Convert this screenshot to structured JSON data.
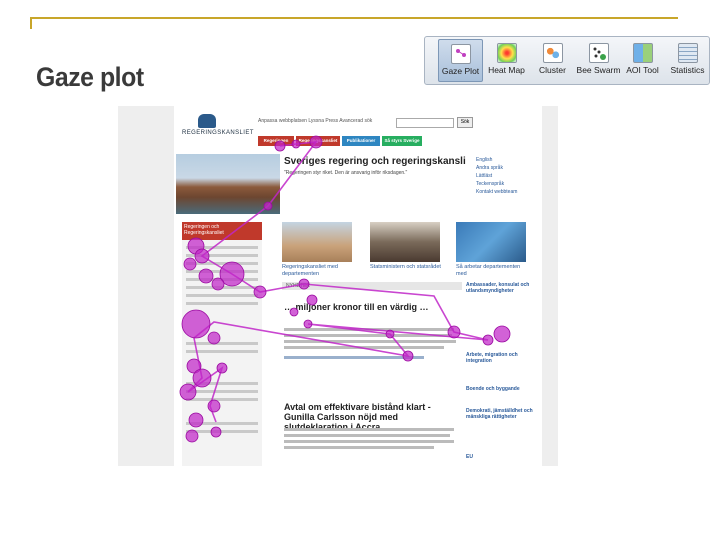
{
  "slide": {
    "title": "Gaze plot",
    "accent_color": "#c8a62a"
  },
  "toolbar": {
    "items": [
      {
        "label": "Gaze Plot",
        "icon": "gaze-plot-icon",
        "active": true
      },
      {
        "label": "Heat Map",
        "icon": "heat-map-icon",
        "active": false
      },
      {
        "label": "Cluster",
        "icon": "cluster-icon",
        "active": false
      },
      {
        "label": "Bee Swarm",
        "icon": "bee-swarm-icon",
        "active": false
      },
      {
        "label": "AOI Tool",
        "icon": "aoi-tool-icon",
        "active": false
      },
      {
        "label": "Statistics",
        "icon": "statistics-icon",
        "active": false
      }
    ]
  },
  "site": {
    "logo_text": "REGERINGSKANSLIET",
    "top_links": "Anpassa webbplatsen   Lyssna   Press   Avancerad sök",
    "search_button": "Sök",
    "nav_tabs": [
      {
        "label": "Regeringen",
        "color": "#c0392b"
      },
      {
        "label": "Regeringskansliet",
        "color": "#c0392b"
      },
      {
        "label": "Publikationer",
        "color": "#2e86c1"
      },
      {
        "label": "Så styrs Sverige",
        "color": "#27ae60"
      }
    ],
    "hero_title": "Sveriges regering och regeringskansli",
    "hero_sub": "\"Regeringen styr riket. Den är ansvarig inför riksdagen.\"",
    "lang_links": [
      "English",
      "Andra språk",
      "Lättläst",
      "Teckenspråk",
      "Kontakt webbteam"
    ],
    "sidebar_head": "Regeringen och Regeringskansliet",
    "thumbs": [
      {
        "caption": "Regeringskansliet med departementen",
        "color": "#c9a27a"
      },
      {
        "caption": "Statsministern och statsrådet",
        "color": "#7a6a5a"
      },
      {
        "caption": "Så arbetar departementen med",
        "color": "#3a7ab8"
      }
    ],
    "news_head": "NYHETER",
    "articles": [
      "… miljoner kronor till en värdig …",
      "Avtal om effektivare bistånd klart - Gunilla Carlsson nöjd med slutdeklaration i Accra"
    ],
    "right_links": [
      "Ambassader, konsulat och utlandsmyndigheter",
      "Arbete, migration och integration",
      "Boende och byggande",
      "Demokrati, jämställdhet och mänskliga rättigheter",
      "EU"
    ]
  }
}
